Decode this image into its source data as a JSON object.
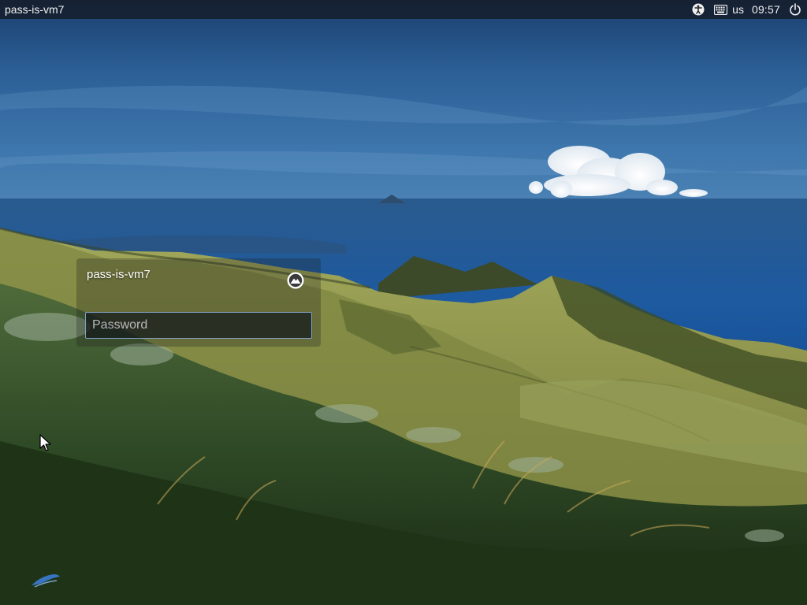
{
  "panel": {
    "hostname": "pass-is-vm7",
    "keyboard_layout": "us",
    "time": "09:57",
    "icons": [
      "accessibility-icon",
      "keyboard-icon",
      "power-icon"
    ]
  },
  "greeter": {
    "username": "pass-is-vm7",
    "session_icon": "session-badge-icon",
    "password": {
      "placeholder": "Password",
      "value": ""
    }
  },
  "colors": {
    "panel_bg": "#141a24",
    "field_border": "#7f9fc0",
    "sky_top": "#1d4f86",
    "sea": "#1e5fa4",
    "hills": "#8a9848"
  }
}
